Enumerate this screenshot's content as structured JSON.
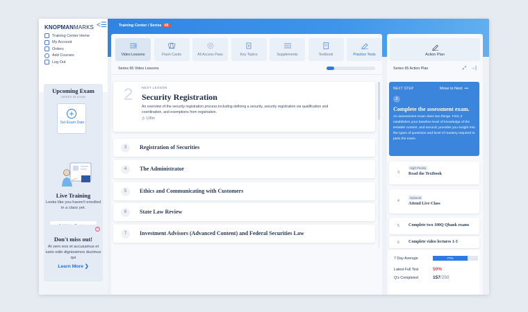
{
  "brand": {
    "logo_bold": "KNOPMAN",
    "logo_thin": "MARKS"
  },
  "nav": [
    {
      "label": "Training Center Home",
      "icon": "home-icon"
    },
    {
      "label": "My Account",
      "icon": "user-icon"
    },
    {
      "label": "Orders",
      "icon": "list-icon"
    },
    {
      "label": "Add Courses",
      "icon": "plus-circle-icon"
    },
    {
      "label": "Log Out",
      "icon": "logout-icon"
    }
  ],
  "upcoming_exam": {
    "title": "Upcoming Exam",
    "subtitle": "SERIES 65 EXAM",
    "set_label": "Set Exam Date"
  },
  "live_training": {
    "title": "Live Training",
    "text": "Looks like you haven't enrolled in a class yet.",
    "button": "Add Live Training"
  },
  "promo": {
    "title": "Don't miss out!",
    "text": "At vero eos et accusamus et iusto odio dignissimos ducimus qui",
    "link": "Learn More"
  },
  "header": {
    "breadcrumb": "Training Center / Series",
    "series": "65"
  },
  "tabs": [
    {
      "label": "Video Lessons",
      "icon": "video-lessons-icon"
    },
    {
      "label": "Flash Cards",
      "icon": "flash-cards-icon"
    },
    {
      "label": "All Access Pass",
      "icon": "all-access-icon"
    },
    {
      "label": "Key Topics",
      "icon": "key-topics-icon"
    },
    {
      "label": "Supplements",
      "icon": "supplements-icon"
    },
    {
      "label": "Textbook",
      "icon": "textbook-icon"
    },
    {
      "label": "Practice Tests",
      "icon": "practice-tests-icon"
    }
  ],
  "main": {
    "subtitle": "Series 65 Video Lessons",
    "progress": 0.15,
    "next_lesson": {
      "number": "2",
      "label": "NEXT LESSON",
      "title": "Security Registration",
      "description": "An overview of the security registration process including defining a security, security registration via qualification and coordination, and exemptions from registration.",
      "duration": "138m"
    },
    "lessons": [
      {
        "number": "3",
        "title": "Registration of Securities"
      },
      {
        "number": "4",
        "title": "The Administrator"
      },
      {
        "number": "5",
        "title": "Ethics and Communicating with Customers"
      },
      {
        "number": "6",
        "title": "State Law Review"
      },
      {
        "number": "7",
        "title": "Investment Advisors (Advanced Content) and Federal Securities Law"
      }
    ]
  },
  "action_plan": {
    "title": "Action Plan",
    "subtitle": "Series 65 Action Plan",
    "next_step": {
      "label": "NEXT STEP",
      "move": "Move to Next",
      "more": "•••",
      "number": "2",
      "title": "Complete the assessment exam.",
      "description": "An assessment exam does two things. First, it establishes your baseline level of knowledge of the testable content, and second, provides you insight into the types of questions and level of mastery required to pass the exam."
    },
    "steps": [
      {
        "number": "3",
        "tag": "High Priority",
        "title": "Read the Textbook"
      },
      {
        "number": "4",
        "tag": "Optional",
        "title": "Attend Live Class"
      },
      {
        "number": "5",
        "tag": "",
        "title": "Complete two 100Q Qbank exams"
      },
      {
        "number": "6",
        "tag": "",
        "title": "Complete video lectures 1-3"
      }
    ]
  },
  "stats": {
    "avg_label": "7 Day Average",
    "avg_value": "77%",
    "avg_fraction": 0.77,
    "full_test_label": "Latest Full Test",
    "full_test_value": "50%",
    "qs_label": "Q's Completed",
    "qs_done": "157",
    "qs_total": "/250"
  },
  "colors": {
    "accent": "#2d7be0",
    "header": "#3a8ee8",
    "danger": "#e0394b"
  }
}
